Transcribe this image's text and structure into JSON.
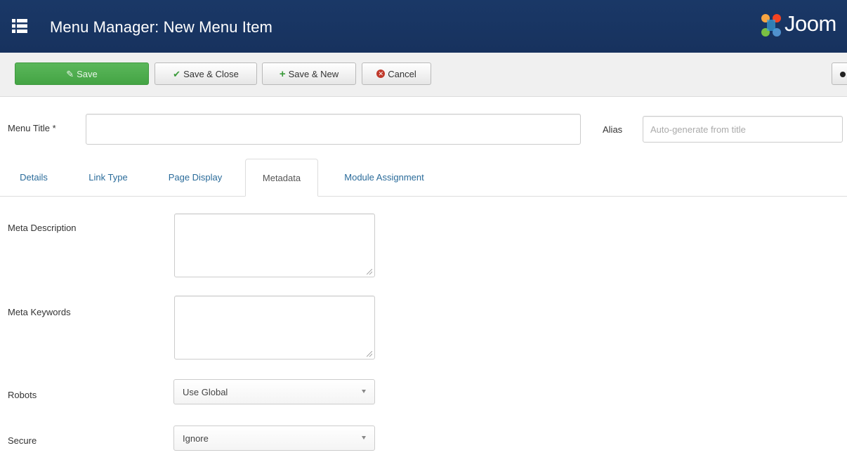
{
  "header": {
    "title": "Menu Manager: New Menu Item",
    "logo_text": "Joom",
    "brand_color": "#1a3867"
  },
  "toolbar": {
    "save_label": "Save",
    "save_close_label": "Save & Close",
    "save_new_label": "Save & New",
    "cancel_label": "Cancel"
  },
  "form": {
    "menu_title_label": "Menu Title *",
    "menu_title_value": "",
    "alias_label": "Alias",
    "alias_placeholder": "Auto-generate from title"
  },
  "tabs": [
    {
      "label": "Details",
      "active": false
    },
    {
      "label": "Link Type",
      "active": false
    },
    {
      "label": "Page Display",
      "active": false
    },
    {
      "label": "Metadata",
      "active": true
    },
    {
      "label": "Module Assignment",
      "active": false
    }
  ],
  "metadata": {
    "meta_description_label": "Meta Description",
    "meta_description_value": "",
    "meta_keywords_label": "Meta Keywords",
    "meta_keywords_value": "",
    "robots_label": "Robots",
    "robots_value": "Use Global",
    "secure_label": "Secure",
    "secure_value": "Ignore"
  }
}
